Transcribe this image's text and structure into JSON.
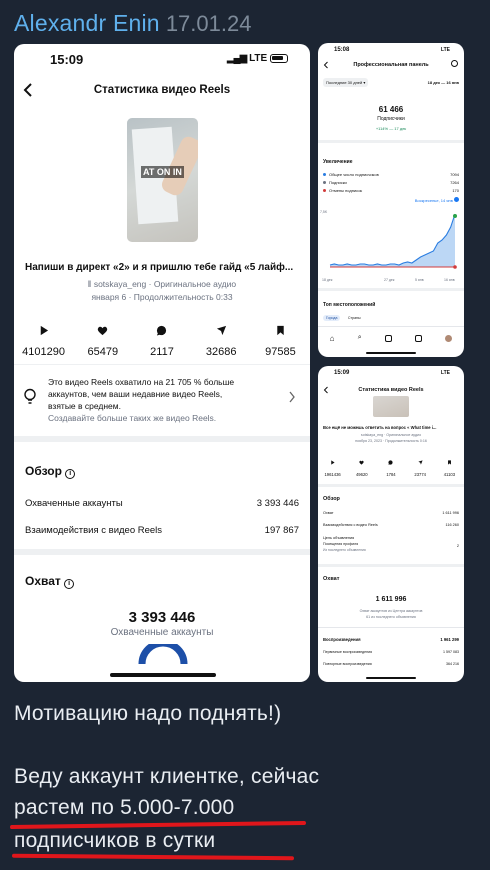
{
  "post": {
    "author": "Alexandr Enin",
    "date": "17.01.24",
    "message_line1": "Мотивацию надо поднять!)",
    "message_line2": "Веду аккаунт клиентке, сейчас",
    "message_line3": "растем по 5.000-7.000",
    "message_line4": "подписчиков в сутки"
  },
  "s1": {
    "time": "15:09",
    "network": "LTE",
    "title": "Статистика видео Reels",
    "thumb_text": "AT ON IN",
    "caption": "Напиши в директ «2» и я пришлю тебе гайд «5 лайф...",
    "meta1": "sotskaya_eng · Оригинальное аудио",
    "meta2": "января 6 · Продолжительность 0:33",
    "stats": [
      {
        "icon": "play-icon",
        "value": "4101290"
      },
      {
        "icon": "heart-icon",
        "value": "65479"
      },
      {
        "icon": "comment-icon",
        "value": "2117"
      },
      {
        "icon": "share-icon",
        "value": "32686"
      },
      {
        "icon": "bookmark-icon",
        "value": "97585"
      }
    ],
    "insight_line1": "Это видео Reels охватило на 21 705 % больше",
    "insight_line2": "аккаунтов, чем ваши недавние видео Reels,",
    "insight_line3": "взятые в среднем.",
    "insight_link": "Создавайте больше таких же видео Reels.",
    "overview_title": "Обзор",
    "overview": [
      {
        "label": "Охваченные аккаунты",
        "value": "3 393 446"
      },
      {
        "label": "Взаимодействия с видео Reels",
        "value": "197 867"
      }
    ],
    "reach_title": "Охват",
    "reach_value": "3 393 446",
    "reach_label": "Охваченные аккаунты"
  },
  "s2": {
    "time": "15:08",
    "network": "LTE",
    "title": "Профессиональная панель",
    "range": "Последние 30 дней",
    "dates": "18 дек — 16 янв",
    "followers_value": "61 466",
    "followers_label": "Подписчики",
    "growth": "+114% — 17 дек",
    "growth_title": "Увеличение",
    "rows": [
      {
        "label": "Общее число подписчиков",
        "value": "7094"
      },
      {
        "label": "Подписки",
        "value": "7264"
      },
      {
        "label": "Отмены подписок",
        "value": "170"
      }
    ],
    "peak": "Воскресенье, 14 янв",
    "y_tick": "7,5K",
    "x_ticks": [
      "18 дек",
      "27 дек",
      "5 янв",
      "16 янв"
    ],
    "locations_title": "Топ местоположений",
    "loc_tabs": [
      "Города",
      "Страны"
    ]
  },
  "s3": {
    "time": "15:09",
    "network": "LTE",
    "title": "Статистика видео Reels",
    "caption": "Все ещё не можешь ответить на вопрос « What time i...",
    "meta1": "sotskaya_eng · Оригинальное аудио",
    "meta2": "ноября 23, 2023 · Продолжительность 0:16",
    "stats": [
      {
        "icon": "play-icon",
        "value": "1961436"
      },
      {
        "icon": "heart-icon",
        "value": "49620"
      },
      {
        "icon": "comment-icon",
        "value": "1784"
      },
      {
        "icon": "share-icon",
        "value": "23774"
      },
      {
        "icon": "bookmark-icon",
        "value": "41103"
      }
    ],
    "overview_title": "Обзор",
    "rows": [
      {
        "label": "Охват",
        "value": "1 611 996"
      },
      {
        "label": "Взаимодействия с видео Reels",
        "value": "116 260"
      }
    ],
    "goal_label": "Цель объявления",
    "goal_sub1": "Посещения профиля",
    "goal_sub2": "Из последнего объявления",
    "goal_value": "2",
    "reach_title": "Охват",
    "reach_value": "1 611 996",
    "reach_note1": "Охват аккаунтов из Центра аккаунтов",
    "reach_note2": "61 из последнего объявления",
    "plays_label": "Воспроизведения",
    "plays_value": "1 961 299",
    "plays_rows": [
      {
        "label": "Первичные воспроизведения",
        "value": "1 597 083"
      },
      {
        "label": "Повторные воспроизведения",
        "value": "364 216"
      }
    ]
  }
}
